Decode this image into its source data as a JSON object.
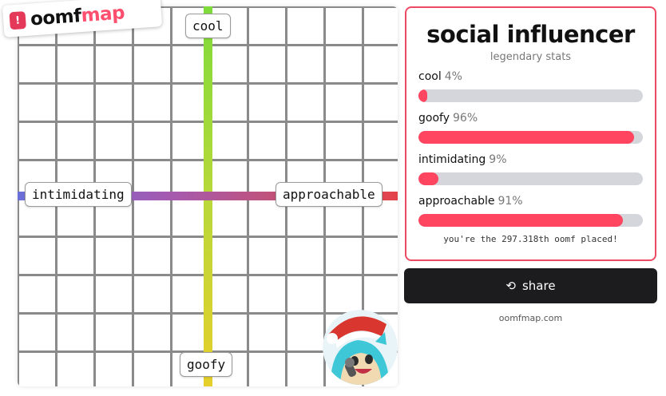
{
  "logo": {
    "pin_glyph": "!",
    "text_a": "oomf",
    "text_b": "map"
  },
  "map": {
    "top_label": "cool",
    "bottom_label": "goofy",
    "left_label": "intimidating",
    "right_label": "approachable",
    "avatar_icon": "avatar-icon"
  },
  "card": {
    "title": "social influencer",
    "subtitle": "legendary stats",
    "stats": [
      {
        "label": "cool",
        "percent": "4%",
        "value": 4
      },
      {
        "label": "goofy",
        "percent": "96%",
        "value": 96
      },
      {
        "label": "intimidating",
        "percent": "9%",
        "value": 9
      },
      {
        "label": "approachable",
        "percent": "91%",
        "value": 91
      }
    ],
    "placed_text": "you're the 297.318th oomf placed!"
  },
  "share": {
    "icon": "repeat-icon",
    "label": "share"
  },
  "footer": {
    "site": "oomfmap.com"
  },
  "colors": {
    "accent": "#ff4560",
    "card_border": "#ef4a63",
    "bar_track": "#d4d6dc",
    "button_bg": "#1c1c1e"
  }
}
